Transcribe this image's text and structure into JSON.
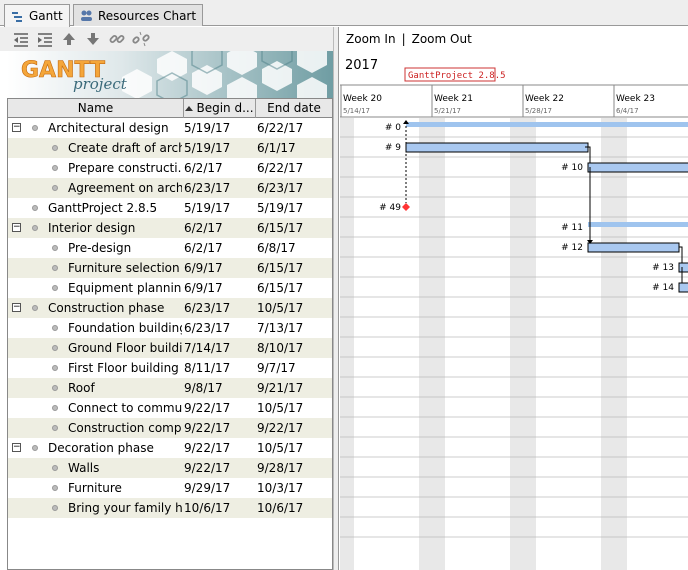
{
  "tabs": [
    {
      "label": "Gantt",
      "icon": "gantt-icon",
      "active": true
    },
    {
      "label": "Resources Chart",
      "icon": "resources-icon",
      "active": false
    }
  ],
  "toolbar": {
    "buttons": [
      "outdent-icon",
      "indent-icon",
      "move-up-icon",
      "move-down-icon",
      "link-icon",
      "unlink-icon"
    ]
  },
  "logo": {
    "text": "GANTT",
    "sub": "project"
  },
  "zoom": {
    "zoom_in": "Zoom In",
    "separator": "|",
    "zoom_out": "Zoom Out"
  },
  "columns": {
    "name": "Name",
    "begin": "Begin d...",
    "end": "End date"
  },
  "tasks": [
    {
      "name": "Architectural design",
      "begin": "5/19/17",
      "end": "6/22/17",
      "level": 0,
      "group": true
    },
    {
      "name": "Create draft of arch...",
      "begin": "5/19/17",
      "end": "6/1/17",
      "level": 1,
      "group": false
    },
    {
      "name": "Prepare constructi...",
      "begin": "6/2/17",
      "end": "6/22/17",
      "level": 1,
      "group": false
    },
    {
      "name": "Agreement on arch...",
      "begin": "6/23/17",
      "end": "6/23/17",
      "level": 1,
      "group": false
    },
    {
      "name": "GanttProject 2.8.5",
      "begin": "5/19/17",
      "end": "5/19/17",
      "level": 0,
      "group": false
    },
    {
      "name": "Interior design",
      "begin": "6/2/17",
      "end": "6/15/17",
      "level": 0,
      "group": true
    },
    {
      "name": "Pre-design",
      "begin": "6/2/17",
      "end": "6/8/17",
      "level": 1,
      "group": false
    },
    {
      "name": "Furniture selection",
      "begin": "6/9/17",
      "end": "6/15/17",
      "level": 1,
      "group": false
    },
    {
      "name": "Equipment planning",
      "begin": "6/9/17",
      "end": "6/15/17",
      "level": 1,
      "group": false
    },
    {
      "name": "Construction phase",
      "begin": "6/23/17",
      "end": "10/5/17",
      "level": 0,
      "group": true
    },
    {
      "name": "Foundation building",
      "begin": "6/23/17",
      "end": "7/13/17",
      "level": 1,
      "group": false
    },
    {
      "name": "Ground Floor buildi...",
      "begin": "7/14/17",
      "end": "8/10/17",
      "level": 1,
      "group": false
    },
    {
      "name": "First Floor building",
      "begin": "8/11/17",
      "end": "9/7/17",
      "level": 1,
      "group": false
    },
    {
      "name": "Roof",
      "begin": "9/8/17",
      "end": "9/21/17",
      "level": 1,
      "group": false
    },
    {
      "name": "Connect to commu...",
      "begin": "9/22/17",
      "end": "10/5/17",
      "level": 1,
      "group": false
    },
    {
      "name": "Construction comp...",
      "begin": "9/22/17",
      "end": "9/22/17",
      "level": 1,
      "group": false
    },
    {
      "name": "Decoration phase",
      "begin": "9/22/17",
      "end": "10/5/17",
      "level": 0,
      "group": true
    },
    {
      "name": "Walls",
      "begin": "9/22/17",
      "end": "9/28/17",
      "level": 1,
      "group": false
    },
    {
      "name": "Furniture",
      "begin": "9/29/17",
      "end": "10/3/17",
      "level": 1,
      "group": false
    },
    {
      "name": "Bring your family h...",
      "begin": "10/6/17",
      "end": "10/6/17",
      "level": 1,
      "group": false
    }
  ],
  "timeline": {
    "year": "2017",
    "milestone_label": "GanttProject 2.8.5",
    "weeks": [
      {
        "label": "Week 20",
        "date": "5/14/17"
      },
      {
        "label": "Week 21",
        "date": "5/21/17"
      },
      {
        "label": "Week 22",
        "date": "5/28/17"
      },
      {
        "label": "Week 23",
        "date": "6/4/17"
      }
    ],
    "task_labels": [
      "# 0",
      "# 9",
      "# 10",
      "# 49",
      "# 11",
      "# 12",
      "# 13",
      "# 14"
    ]
  },
  "colors": {
    "bar": "#a9c8f0",
    "bar_border": "#000000",
    "summary": "#9fc4ee",
    "milestone": "#ff3333",
    "weekend": "#e8e8e8",
    "alt_row": "#eeeee2"
  }
}
